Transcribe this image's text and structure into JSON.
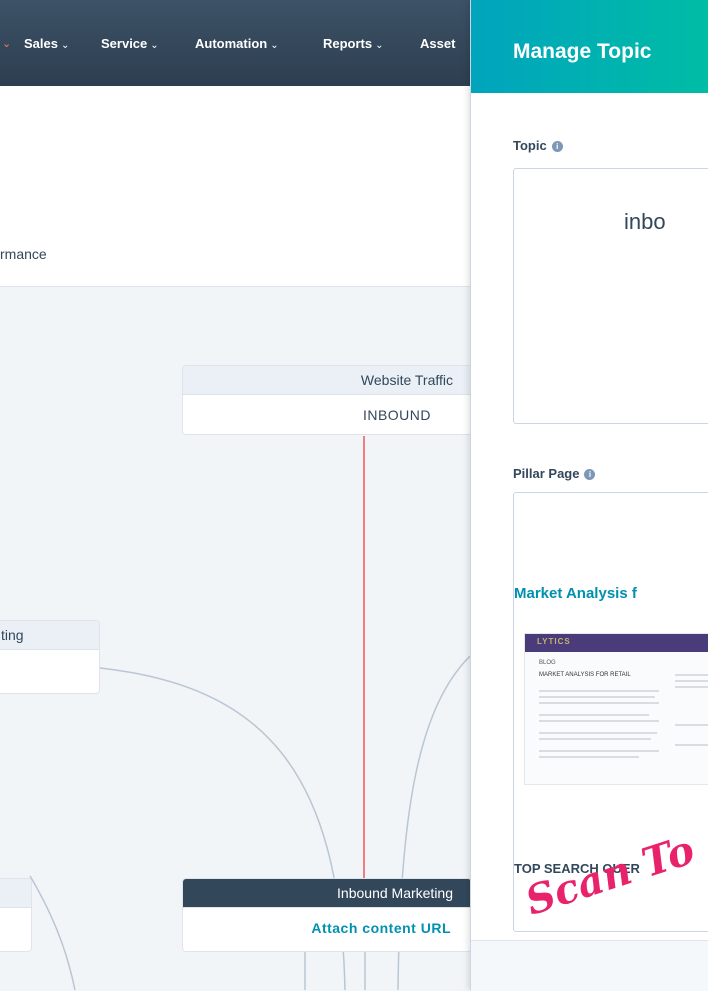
{
  "nav": {
    "items": [
      "Sales",
      "Service",
      "Automation",
      "Reports",
      "Asset"
    ]
  },
  "header": {
    "tab_partial": "rmance"
  },
  "canvas": {
    "website_traffic": {
      "title": "Website Traffic",
      "value": "INBOUND"
    },
    "left_card": {
      "title": "ting"
    },
    "inbound_marketing": {
      "title": "Inbound Marketing",
      "action": "Attach content URL"
    }
  },
  "panel": {
    "title": "Manage Topic",
    "topic_label": "Topic",
    "topic_value": "inbo",
    "pillar_label": "Pillar Page",
    "pillar_title": "Market Analysis f",
    "thumbnail": {
      "logo": "LYTICS",
      "blog": "BLOG",
      "heading": "MARKET ANALYSIS FOR RETAIL"
    },
    "top_search": "TOP SEARCH QUER"
  },
  "overlay": {
    "handwritten": "Scan To"
  },
  "colors": {
    "nav_bg": "#2d3e50",
    "panel_header": "#00a4bd",
    "link": "#0091ae",
    "connector_red": "#f2545b",
    "handwritten": "#e8236b"
  }
}
